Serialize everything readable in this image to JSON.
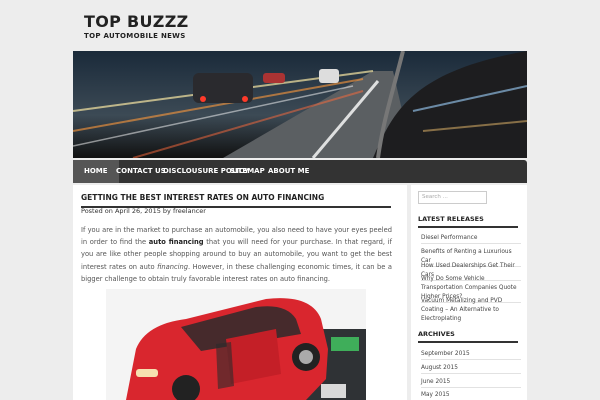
{
  "site": {
    "title": "TOP BUZZZ",
    "tagline": "TOP AUTOMOBILE NEWS"
  },
  "nav": [
    {
      "label": "HOME"
    },
    {
      "label": "CONTACT US"
    },
    {
      "label": "DISCLOUSURE POLICY"
    },
    {
      "label": "SITEMAP"
    },
    {
      "label": "ABOUT ME"
    }
  ],
  "post": {
    "title": "GETTING THE BEST INTEREST RATES ON AUTO FINANCING",
    "meta_posted": "Posted on",
    "date": "April 26, 2015",
    "meta_by": "by",
    "author": "freelancer",
    "p1": "If you are in the market to purchase an automobile, you also need to have your eyes peeled in order to find the",
    "bold1": "auto financing",
    "p2": "that you will need for your purchase. In that regard, if you are like other people shopping around to buy an automobile, you want to get the best interest rates on auto",
    "italic1": "financing",
    "p3": ". However, in these challenging economic times, it can be a bigger challenge to obtain truly favorable interest rates on auto financing."
  },
  "sidebar": {
    "search_placeholder": "Search ...",
    "latest_title": "LATEST RELEASES",
    "latest": [
      "Diesel Performance",
      "Benefits of Renting a Luxurious Car",
      "How Used Dealerships Get Their Cars",
      "Why Do Some Vehicle Transportation Companies Quote Higher Prices?",
      "Vacuum Metalizing and PVD Coating – An Alternative to Electroplating"
    ],
    "archives_title": "ARCHIVES",
    "archives": [
      "September 2015",
      "August 2015",
      "June 2015",
      "May 2015"
    ]
  },
  "colors": {
    "nav_bg": "#333333",
    "nav_active": "#555555",
    "page_bg": "#ededed",
    "accent_car": "#d9262e"
  }
}
